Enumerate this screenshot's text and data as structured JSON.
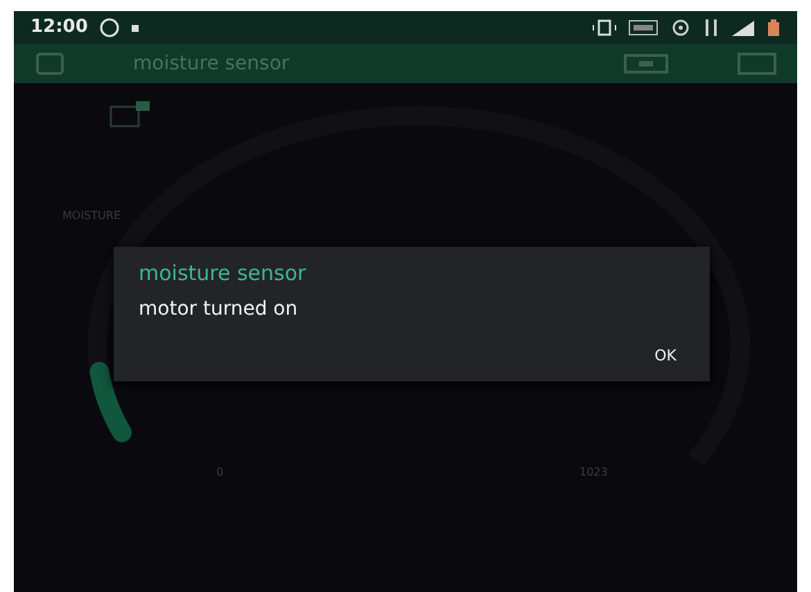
{
  "status_bar": {
    "time": "12:00"
  },
  "app_bar": {
    "title": "moisture sensor"
  },
  "gauge": {
    "label": "MOISTURE",
    "min_label": "0",
    "max_label": "1023"
  },
  "dialog": {
    "title": "moisture sensor",
    "message": "motor turned on",
    "button": "OK"
  }
}
